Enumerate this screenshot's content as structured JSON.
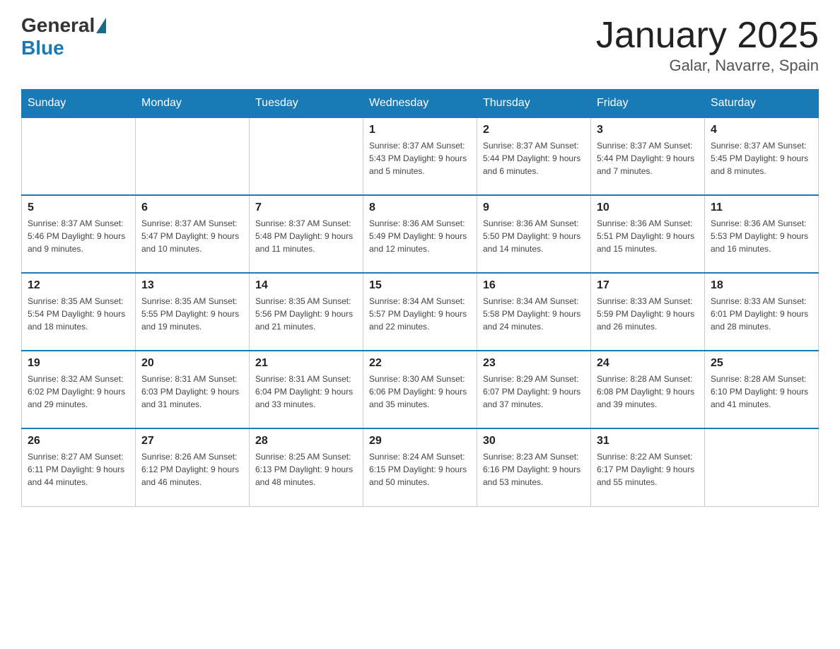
{
  "header": {
    "logo_general": "General",
    "logo_blue": "Blue",
    "title": "January 2025",
    "subtitle": "Galar, Navarre, Spain"
  },
  "days_of_week": [
    "Sunday",
    "Monday",
    "Tuesday",
    "Wednesday",
    "Thursday",
    "Friday",
    "Saturday"
  ],
  "weeks": [
    [
      {
        "day": "",
        "info": ""
      },
      {
        "day": "",
        "info": ""
      },
      {
        "day": "",
        "info": ""
      },
      {
        "day": "1",
        "info": "Sunrise: 8:37 AM\nSunset: 5:43 PM\nDaylight: 9 hours and 5 minutes."
      },
      {
        "day": "2",
        "info": "Sunrise: 8:37 AM\nSunset: 5:44 PM\nDaylight: 9 hours and 6 minutes."
      },
      {
        "day": "3",
        "info": "Sunrise: 8:37 AM\nSunset: 5:44 PM\nDaylight: 9 hours and 7 minutes."
      },
      {
        "day": "4",
        "info": "Sunrise: 8:37 AM\nSunset: 5:45 PM\nDaylight: 9 hours and 8 minutes."
      }
    ],
    [
      {
        "day": "5",
        "info": "Sunrise: 8:37 AM\nSunset: 5:46 PM\nDaylight: 9 hours and 9 minutes."
      },
      {
        "day": "6",
        "info": "Sunrise: 8:37 AM\nSunset: 5:47 PM\nDaylight: 9 hours and 10 minutes."
      },
      {
        "day": "7",
        "info": "Sunrise: 8:37 AM\nSunset: 5:48 PM\nDaylight: 9 hours and 11 minutes."
      },
      {
        "day": "8",
        "info": "Sunrise: 8:36 AM\nSunset: 5:49 PM\nDaylight: 9 hours and 12 minutes."
      },
      {
        "day": "9",
        "info": "Sunrise: 8:36 AM\nSunset: 5:50 PM\nDaylight: 9 hours and 14 minutes."
      },
      {
        "day": "10",
        "info": "Sunrise: 8:36 AM\nSunset: 5:51 PM\nDaylight: 9 hours and 15 minutes."
      },
      {
        "day": "11",
        "info": "Sunrise: 8:36 AM\nSunset: 5:53 PM\nDaylight: 9 hours and 16 minutes."
      }
    ],
    [
      {
        "day": "12",
        "info": "Sunrise: 8:35 AM\nSunset: 5:54 PM\nDaylight: 9 hours and 18 minutes."
      },
      {
        "day": "13",
        "info": "Sunrise: 8:35 AM\nSunset: 5:55 PM\nDaylight: 9 hours and 19 minutes."
      },
      {
        "day": "14",
        "info": "Sunrise: 8:35 AM\nSunset: 5:56 PM\nDaylight: 9 hours and 21 minutes."
      },
      {
        "day": "15",
        "info": "Sunrise: 8:34 AM\nSunset: 5:57 PM\nDaylight: 9 hours and 22 minutes."
      },
      {
        "day": "16",
        "info": "Sunrise: 8:34 AM\nSunset: 5:58 PM\nDaylight: 9 hours and 24 minutes."
      },
      {
        "day": "17",
        "info": "Sunrise: 8:33 AM\nSunset: 5:59 PM\nDaylight: 9 hours and 26 minutes."
      },
      {
        "day": "18",
        "info": "Sunrise: 8:33 AM\nSunset: 6:01 PM\nDaylight: 9 hours and 28 minutes."
      }
    ],
    [
      {
        "day": "19",
        "info": "Sunrise: 8:32 AM\nSunset: 6:02 PM\nDaylight: 9 hours and 29 minutes."
      },
      {
        "day": "20",
        "info": "Sunrise: 8:31 AM\nSunset: 6:03 PM\nDaylight: 9 hours and 31 minutes."
      },
      {
        "day": "21",
        "info": "Sunrise: 8:31 AM\nSunset: 6:04 PM\nDaylight: 9 hours and 33 minutes."
      },
      {
        "day": "22",
        "info": "Sunrise: 8:30 AM\nSunset: 6:06 PM\nDaylight: 9 hours and 35 minutes."
      },
      {
        "day": "23",
        "info": "Sunrise: 8:29 AM\nSunset: 6:07 PM\nDaylight: 9 hours and 37 minutes."
      },
      {
        "day": "24",
        "info": "Sunrise: 8:28 AM\nSunset: 6:08 PM\nDaylight: 9 hours and 39 minutes."
      },
      {
        "day": "25",
        "info": "Sunrise: 8:28 AM\nSunset: 6:10 PM\nDaylight: 9 hours and 41 minutes."
      }
    ],
    [
      {
        "day": "26",
        "info": "Sunrise: 8:27 AM\nSunset: 6:11 PM\nDaylight: 9 hours and 44 minutes."
      },
      {
        "day": "27",
        "info": "Sunrise: 8:26 AM\nSunset: 6:12 PM\nDaylight: 9 hours and 46 minutes."
      },
      {
        "day": "28",
        "info": "Sunrise: 8:25 AM\nSunset: 6:13 PM\nDaylight: 9 hours and 48 minutes."
      },
      {
        "day": "29",
        "info": "Sunrise: 8:24 AM\nSunset: 6:15 PM\nDaylight: 9 hours and 50 minutes."
      },
      {
        "day": "30",
        "info": "Sunrise: 8:23 AM\nSunset: 6:16 PM\nDaylight: 9 hours and 53 minutes."
      },
      {
        "day": "31",
        "info": "Sunrise: 8:22 AM\nSunset: 6:17 PM\nDaylight: 9 hours and 55 minutes."
      },
      {
        "day": "",
        "info": ""
      }
    ]
  ]
}
